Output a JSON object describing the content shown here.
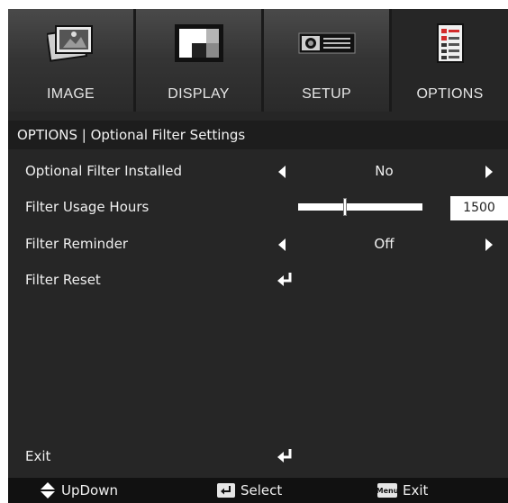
{
  "tabs": [
    {
      "label": "IMAGE",
      "icon": "image-icon"
    },
    {
      "label": "DISPLAY",
      "icon": "display-icon"
    },
    {
      "label": "SETUP",
      "icon": "projector-icon"
    },
    {
      "label": "OPTIONS",
      "icon": "options-checklist-icon",
      "active": true
    }
  ],
  "breadcrumb": "OPTIONS | Optional Filter Settings",
  "rows": {
    "filter_installed": {
      "label": "Optional Filter Installed",
      "value": "No"
    },
    "usage_hours": {
      "label": "Filter Usage Hours",
      "value": "1500",
      "slider_fraction": 0.38
    },
    "reminder": {
      "label": "Filter Reminder",
      "value": "Off"
    },
    "reset": {
      "label": "Filter Reset"
    },
    "exit": {
      "label": "Exit"
    }
  },
  "footer": {
    "updown_label": "UpDown",
    "select_label": "Select",
    "exit_label": "Exit",
    "menu_key_label": "Menu"
  },
  "colors": {
    "background": "#262626",
    "tab_bar": "#1a1a1a",
    "accent_red": "#d22b2b"
  }
}
